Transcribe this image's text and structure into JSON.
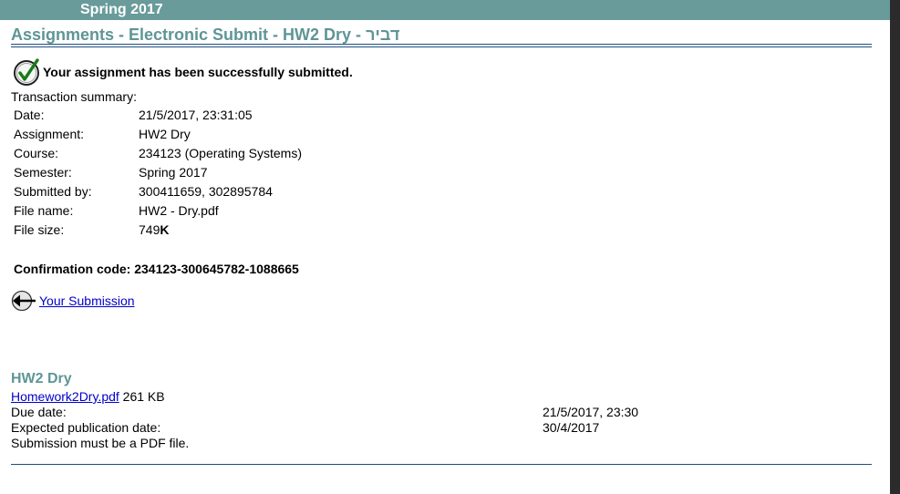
{
  "header": {
    "semester": "Spring 2017",
    "page_title": "Assignments - Electronic Submit - HW2 Dry - דביר"
  },
  "status": {
    "message": "Your assignment has been successfully submitted.",
    "icon": "check-circle-icon"
  },
  "summary": {
    "heading": "Transaction summary:",
    "rows": [
      {
        "label": "Date:",
        "value": "21/5/2017, 23:31:05"
      },
      {
        "label": "Assignment:",
        "value": "HW2 Dry"
      },
      {
        "label": "Course:",
        "value": "234123 (Operating Systems)"
      },
      {
        "label": "Semester:",
        "value": "Spring 2017"
      },
      {
        "label": "Submitted by:",
        "value": "300411659, 302895784"
      },
      {
        "label": "File name:",
        "value": "HW2 - Dry.pdf"
      }
    ],
    "file_size_label": "File size:",
    "file_size_number": "749",
    "file_size_unit": "K"
  },
  "confirmation": {
    "text": "Confirmation code: 234123-300645782-1088665"
  },
  "navigation": {
    "back_icon": "back-arrow-icon",
    "back_link": " Your Submission"
  },
  "assignment": {
    "title": "HW2 Dry",
    "file_link": "Homework2Dry.pdf",
    "file_size": " 261 KB",
    "due_label": "Due date:",
    "due_value": "21/5/2017, 23:30",
    "publication_label": "Expected publication date:",
    "publication_value": "30/4/2017",
    "note": "Submission must be a PDF file."
  },
  "colors": {
    "header_bar": "#699b9b",
    "title_teal": "#5f9595",
    "rule": "#1f4f7f",
    "link": "#0000cc",
    "check_green": "#1a7a1a"
  }
}
